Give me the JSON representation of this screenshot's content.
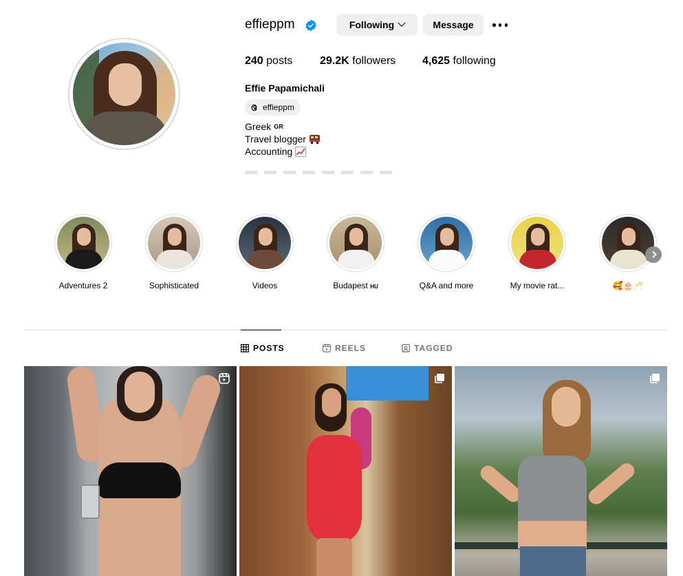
{
  "profile": {
    "username": "effieppm",
    "verified": true,
    "following_label": "Following",
    "message_label": "Message",
    "stats": {
      "posts_count": "240",
      "posts_label": "posts",
      "followers_count": "29.2K",
      "followers_label": "followers",
      "following_count": "4,625",
      "following_label": "following"
    },
    "full_name": "Effie Papamichali",
    "threads_handle": "effieppm",
    "bio": {
      "line1": "Greek",
      "line1_flag": "GR",
      "line2": "Travel blogger",
      "line3": "Accounting"
    }
  },
  "highlights": [
    {
      "label": "Adventures 2"
    },
    {
      "label": "Sophisticated"
    },
    {
      "label": "Videos"
    },
    {
      "label": "Budapest",
      "flag": "HU"
    },
    {
      "label": "Q&A and more"
    },
    {
      "label": "My movie rat..."
    },
    {
      "label": "🥰🎂🥂"
    }
  ],
  "tabs": {
    "posts": "POSTS",
    "reels": "REELS",
    "tagged": "TAGGED",
    "active": "posts"
  },
  "posts": [
    {
      "type": "reel"
    },
    {
      "type": "carousel"
    },
    {
      "type": "carousel"
    }
  ],
  "colors": {
    "verified_blue": "#0095f6",
    "button_bg": "#efefef",
    "divider": "#dbdbdb",
    "muted_text": "#737373"
  }
}
